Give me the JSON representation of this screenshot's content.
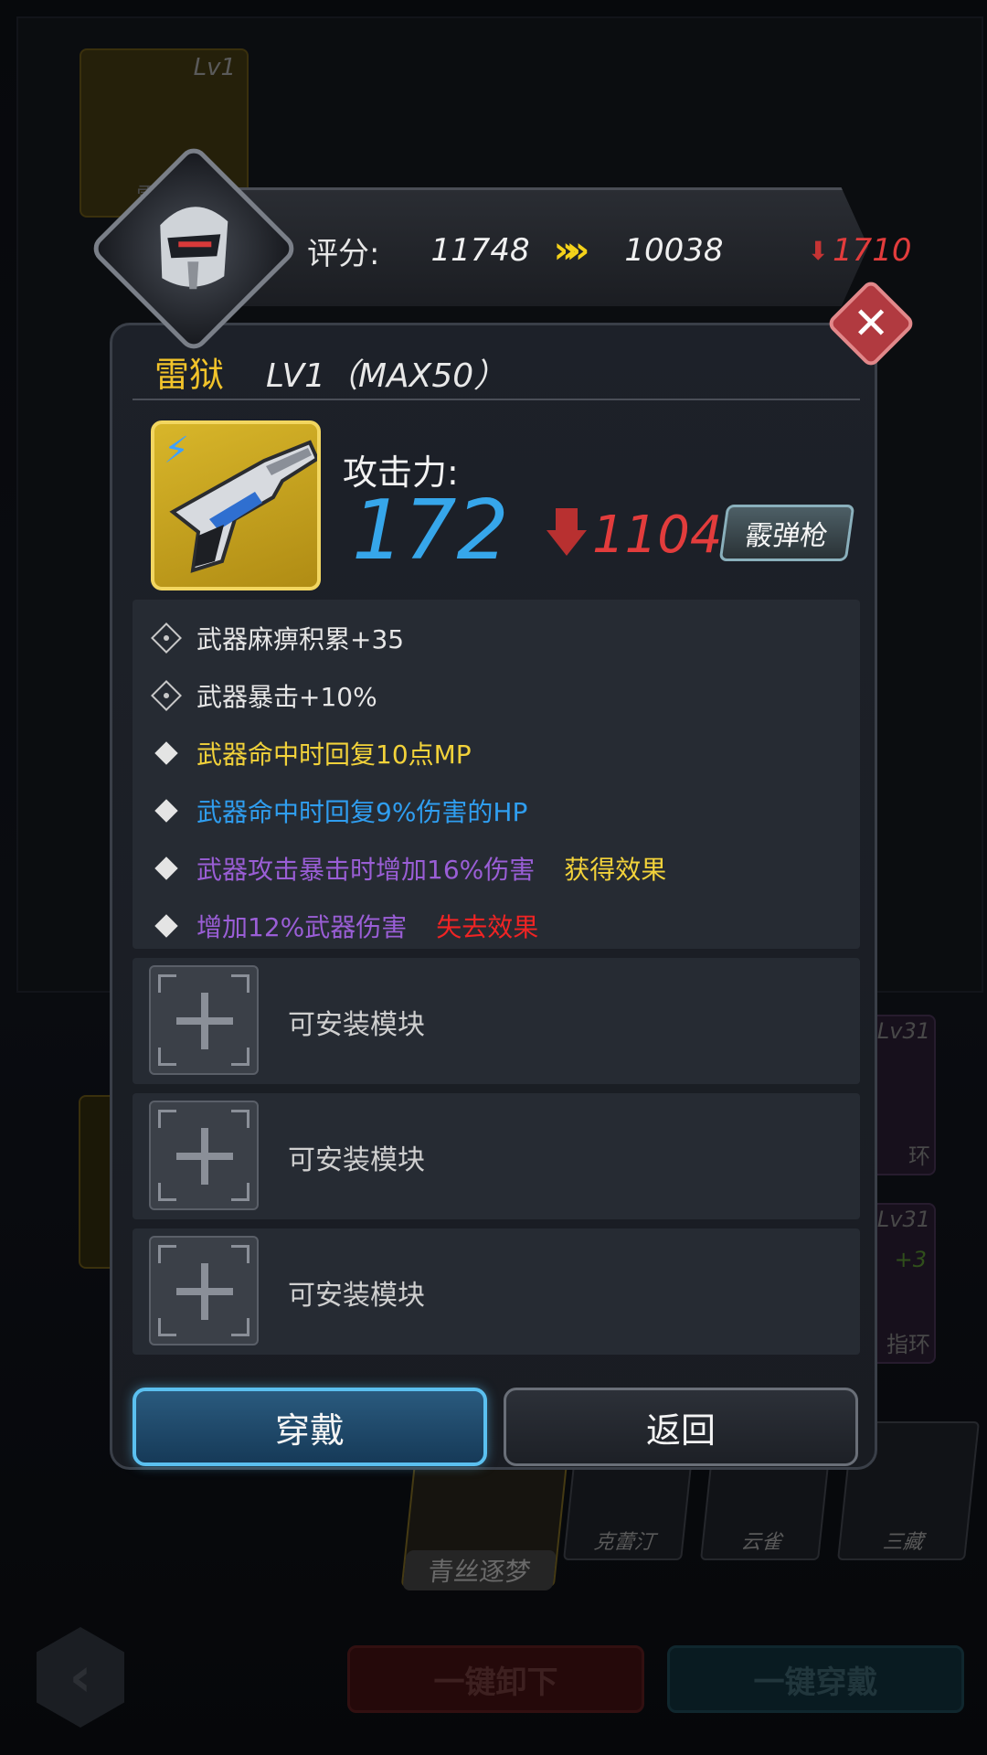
{
  "background": {
    "weapon_card": {
      "level": "Lv1",
      "name": "雷"
    },
    "rings": [
      {
        "level": "Lv31",
        "plus": "",
        "name": "环"
      },
      {
        "level": "Lv31",
        "plus": "+3",
        "name": "指环"
      }
    ],
    "characters": [
      {
        "name": "青丝逐梦",
        "selected": true
      },
      {
        "name": "克蕾汀",
        "selected": false
      },
      {
        "name": "云雀",
        "selected": false
      },
      {
        "name": "三藏",
        "selected": false
      }
    ],
    "back_icon": "chevron-left-icon",
    "unequip_all_label": "一键卸下",
    "equip_all_label": "一键穿戴"
  },
  "score": {
    "label": "评分:",
    "old_value": "11748",
    "arrow_icon": "double-chevron-right-icon",
    "new_value": "10038",
    "diff_icon": "down-arrow-icon",
    "diff_value": "1710"
  },
  "item": {
    "name": "雷狱",
    "level": "LV1（MAX50）",
    "element_icon": "lightning-icon",
    "attack_label": "攻击力:",
    "attack_value": "172",
    "attack_diff": "1104",
    "weapon_type": "霰弹枪"
  },
  "attributes": [
    {
      "text": "武器麻痹积累+35",
      "status": "",
      "color": "white",
      "bullet": "lock"
    },
    {
      "text": "武器暴击+10%",
      "status": "",
      "color": "white",
      "bullet": "lock"
    },
    {
      "text": "武器命中时回复10点MP",
      "status": "",
      "color": "yellow",
      "bullet": "diamond"
    },
    {
      "text": "武器命中时回复9%伤害的HP",
      "status": "",
      "color": "blue",
      "bullet": "diamond"
    },
    {
      "text": "武器攻击暴击时增加16%伤害",
      "status": "获得效果",
      "color": "purple",
      "bullet": "diamond"
    },
    {
      "text": "增加12%武器伤害",
      "status": "失去效果",
      "color": "purple",
      "bullet": "diamond"
    }
  ],
  "modules": [
    {
      "label": "可安装模块"
    },
    {
      "label": "可安装模块"
    },
    {
      "label": "可安装模块"
    }
  ],
  "buttons": {
    "wear": "穿戴",
    "back": "返回",
    "close_icon": "close-icon"
  },
  "colors": {
    "attack_value": "#36a6ea",
    "diff_red": "#e23c3c",
    "item_name": "#f2c32a",
    "gain_effect": "#f2d23a",
    "lose_effect": "#f02424"
  }
}
